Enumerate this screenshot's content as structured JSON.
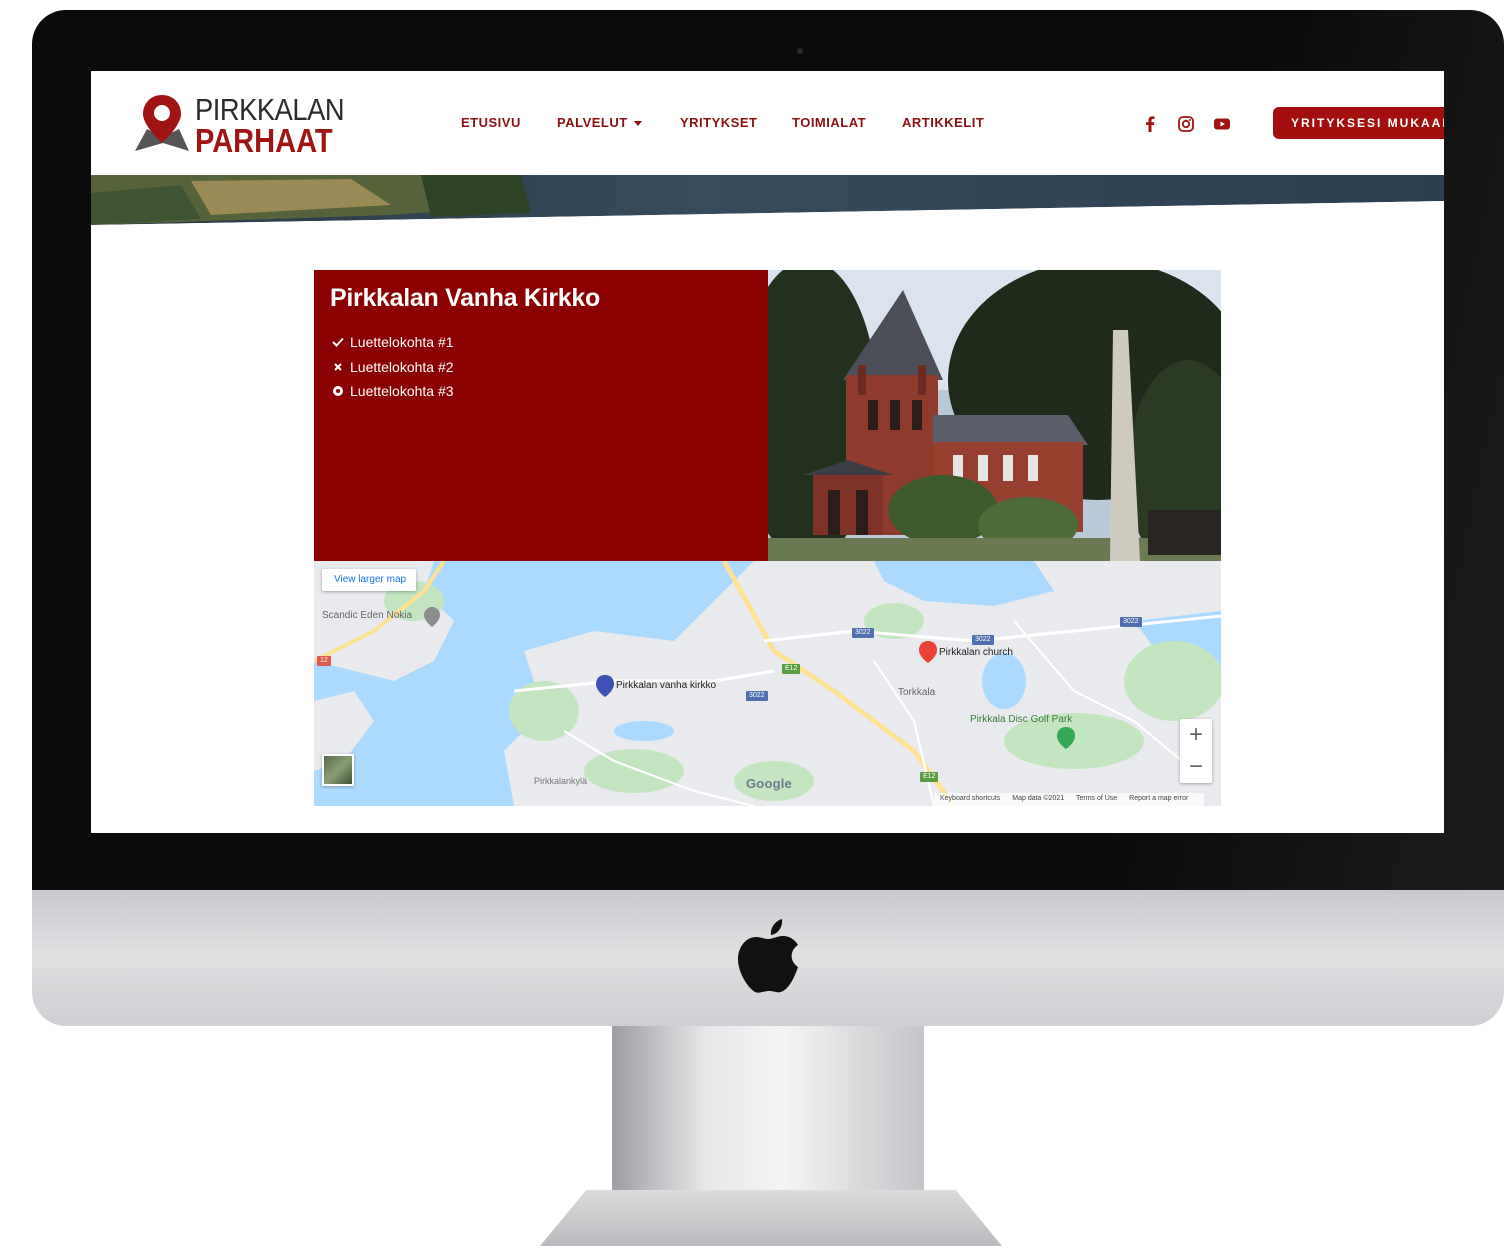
{
  "logo": {
    "line1": "PIRKKALAN",
    "line2": "PARHAAT"
  },
  "nav": {
    "items": [
      {
        "label": "ETUSIVU"
      },
      {
        "label": "PALVELUT"
      },
      {
        "label": "YRITYKSET"
      },
      {
        "label": "TOIMIALAT"
      },
      {
        "label": "ARTIKKELIT"
      }
    ],
    "cta_label": "YRITYKSESI MUKAAN"
  },
  "social": [
    "facebook-icon",
    "instagram-icon",
    "youtube-icon"
  ],
  "card": {
    "title": "Pirkkalan Vanha Kirkko",
    "list": [
      {
        "icon": "check-icon",
        "label": "Luettelokohta #1"
      },
      {
        "icon": "times-icon",
        "label": "Luettelokohta #2"
      },
      {
        "icon": "circle-dot-icon",
        "label": "Luettelokohta #3"
      }
    ]
  },
  "map": {
    "larger_map": "View larger map",
    "places": {
      "scandic": "Scandic Eden Nokia",
      "old_church": "Pirkkalan vanha kirkko",
      "church": "Pirkkalan church",
      "torkkala": "Torkkala",
      "disc_golf": "Pirkkala Disc Golf Park",
      "pirkkalankyla": "Pirkkalankylä"
    },
    "roads": [
      "3022",
      "3022",
      "3022",
      "3022",
      "E12",
      "E12",
      "12"
    ],
    "google": "Google",
    "footer": {
      "shortcuts": "Keyboard shortcuts",
      "map_data": "Map data ©2021",
      "terms": "Terms of Use",
      "report": "Report a map error"
    },
    "zoom_in": "+",
    "zoom_out": "−"
  },
  "colors": {
    "brand_red": "#a01414",
    "card_red": "#8b0000",
    "nav_text": "#8b1010"
  }
}
